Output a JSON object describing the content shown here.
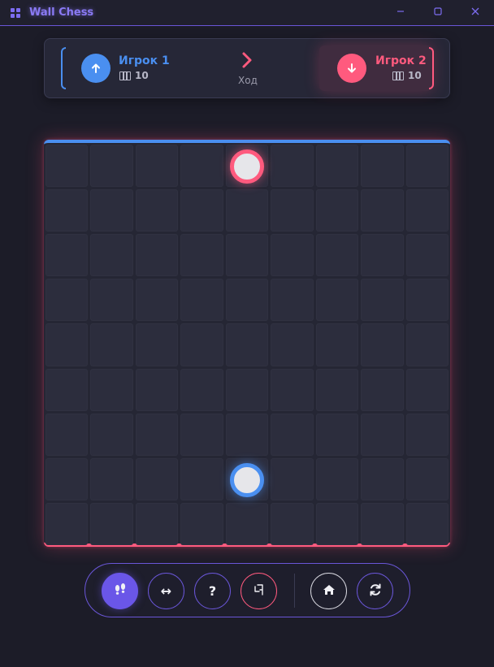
{
  "app": {
    "title": "Wall Chess"
  },
  "window": {
    "minimize_icon": "minimize-icon",
    "maximize_icon": "maximize-icon",
    "close_icon": "close-icon"
  },
  "players": [
    {
      "name": "Игрок 1",
      "walls": "10",
      "color": "#4a8ff0",
      "icon": "arrow-up-icon"
    },
    {
      "name": "Игрок 2",
      "walls": "10",
      "color": "#ff5a7e",
      "icon": "arrow-down-icon"
    }
  ],
  "turn": {
    "label": "Ход",
    "active_player": 2
  },
  "board": {
    "rows": 9,
    "cols": 9,
    "pawns": [
      {
        "player": 2,
        "row": 1,
        "col": 5,
        "color": "#ff5a7e"
      },
      {
        "player": 1,
        "row": 8,
        "col": 5,
        "color": "#4a8ff0"
      }
    ],
    "walls_placed": []
  },
  "toolbar": {
    "buttons": [
      {
        "id": "move",
        "icon": "footsteps-icon",
        "active": true
      },
      {
        "id": "wall",
        "icon": "horizontal-arrows-icon",
        "glyph": "↔"
      },
      {
        "id": "help",
        "icon": "question-icon",
        "glyph": "?"
      },
      {
        "id": "undo",
        "icon": "undo-icon"
      },
      {
        "id": "home",
        "icon": "home-icon"
      },
      {
        "id": "restart",
        "icon": "refresh-icon"
      }
    ]
  },
  "colors": {
    "accent": "#6a56e8",
    "player1": "#4a8ff0",
    "player2": "#ff5a7e",
    "background": "#1c1c28"
  }
}
